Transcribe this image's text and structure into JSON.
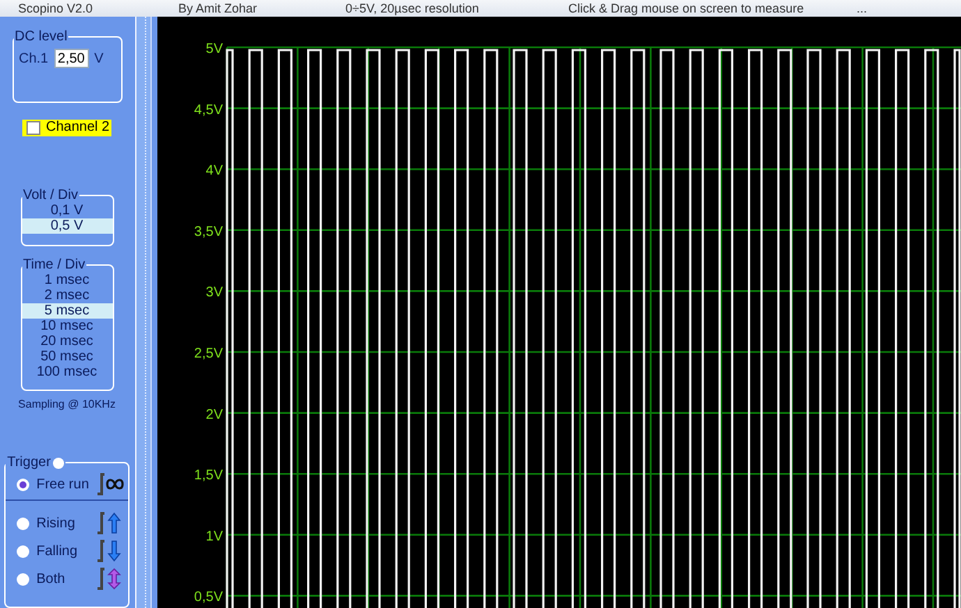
{
  "title_bar": {
    "texts": [
      "Scopino V2.0",
      "By Amit Zohar",
      "0÷5V, 20µsec resolution",
      "Click & Drag mouse on screen to measure",
      "..."
    ]
  },
  "dc_level": {
    "title": "DC level",
    "channel": "Ch.1",
    "value": "2,50",
    "unit": "V"
  },
  "channel_2": {
    "label": "Channel 2",
    "checked": false
  },
  "volt_div": {
    "title": "Volt / Div",
    "options": [
      {
        "label": "0,1 V",
        "selected": false
      },
      {
        "label": "0,5 V",
        "selected": true
      }
    ]
  },
  "time_div": {
    "title": "Time / Div",
    "options": [
      {
        "label": "1 msec",
        "selected": false
      },
      {
        "label": "2 msec",
        "selected": false
      },
      {
        "label": "5 msec",
        "selected": true
      },
      {
        "label": "10 msec",
        "selected": false
      },
      {
        "label": "20 msec",
        "selected": false
      },
      {
        "label": "50 msec",
        "selected": false
      },
      {
        "label": "100 msec",
        "selected": false
      }
    ]
  },
  "sampling": "Sampling @ 10KHz",
  "trigger": {
    "title": "Trigger",
    "modes": [
      {
        "kind": "free",
        "label": "Free run",
        "selected": true
      },
      {
        "kind": "rising",
        "label": "Rising",
        "selected": false
      },
      {
        "kind": "falling",
        "label": "Falling",
        "selected": false
      },
      {
        "kind": "both",
        "label": "Both",
        "selected": false
      }
    ]
  },
  "scope": {
    "y_labels": [
      "5V",
      "4,5V",
      "4V",
      "3,5V",
      "3V",
      "2,5V",
      "2V",
      "1,5V",
      "1V",
      "0,5V"
    ]
  }
}
